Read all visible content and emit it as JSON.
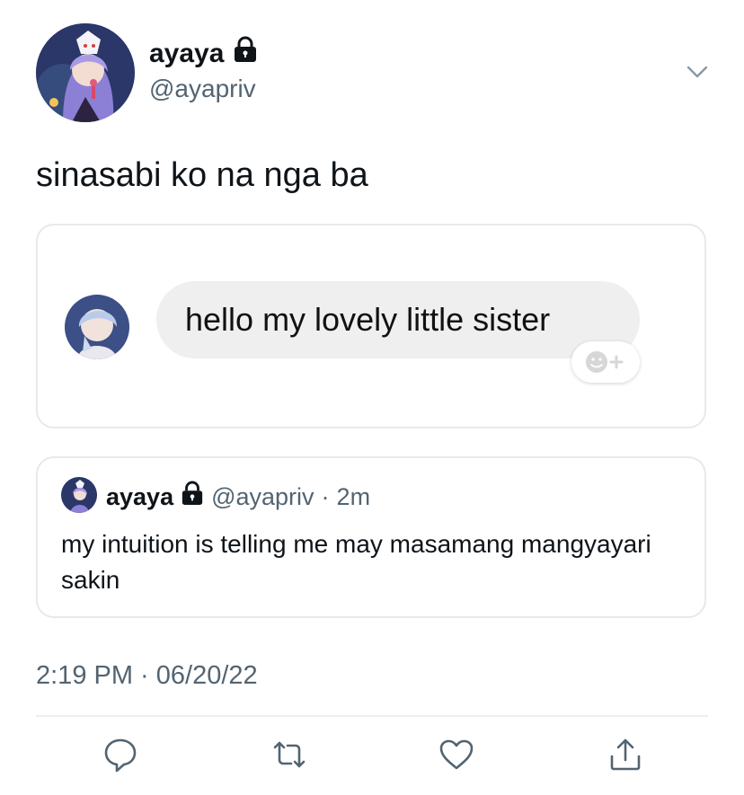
{
  "author": {
    "display_name": "ayaya",
    "username": "@ayapriv",
    "protected_icon": "lock-icon"
  },
  "tweet": {
    "text": "sinasabi ko na nga ba",
    "timestamp": "2:19 PM · 06/20/22"
  },
  "media": {
    "message_text": "hello my lovely little sister",
    "reaction_icon": "add-reaction-icon"
  },
  "quote": {
    "display_name": "ayaya",
    "username": "@ayapriv",
    "separator": "·",
    "age": "2m",
    "text": "my intuition is telling me may masamang mangyayari sakin"
  },
  "actions": {
    "reply_icon": "reply-icon",
    "retweet_icon": "retweet-icon",
    "like_icon": "like-icon",
    "share_icon": "share-icon"
  },
  "colors": {
    "text": "#0f1419",
    "secondary": "#536471",
    "border": "#e6e9ec",
    "bubble": "#efefef"
  }
}
